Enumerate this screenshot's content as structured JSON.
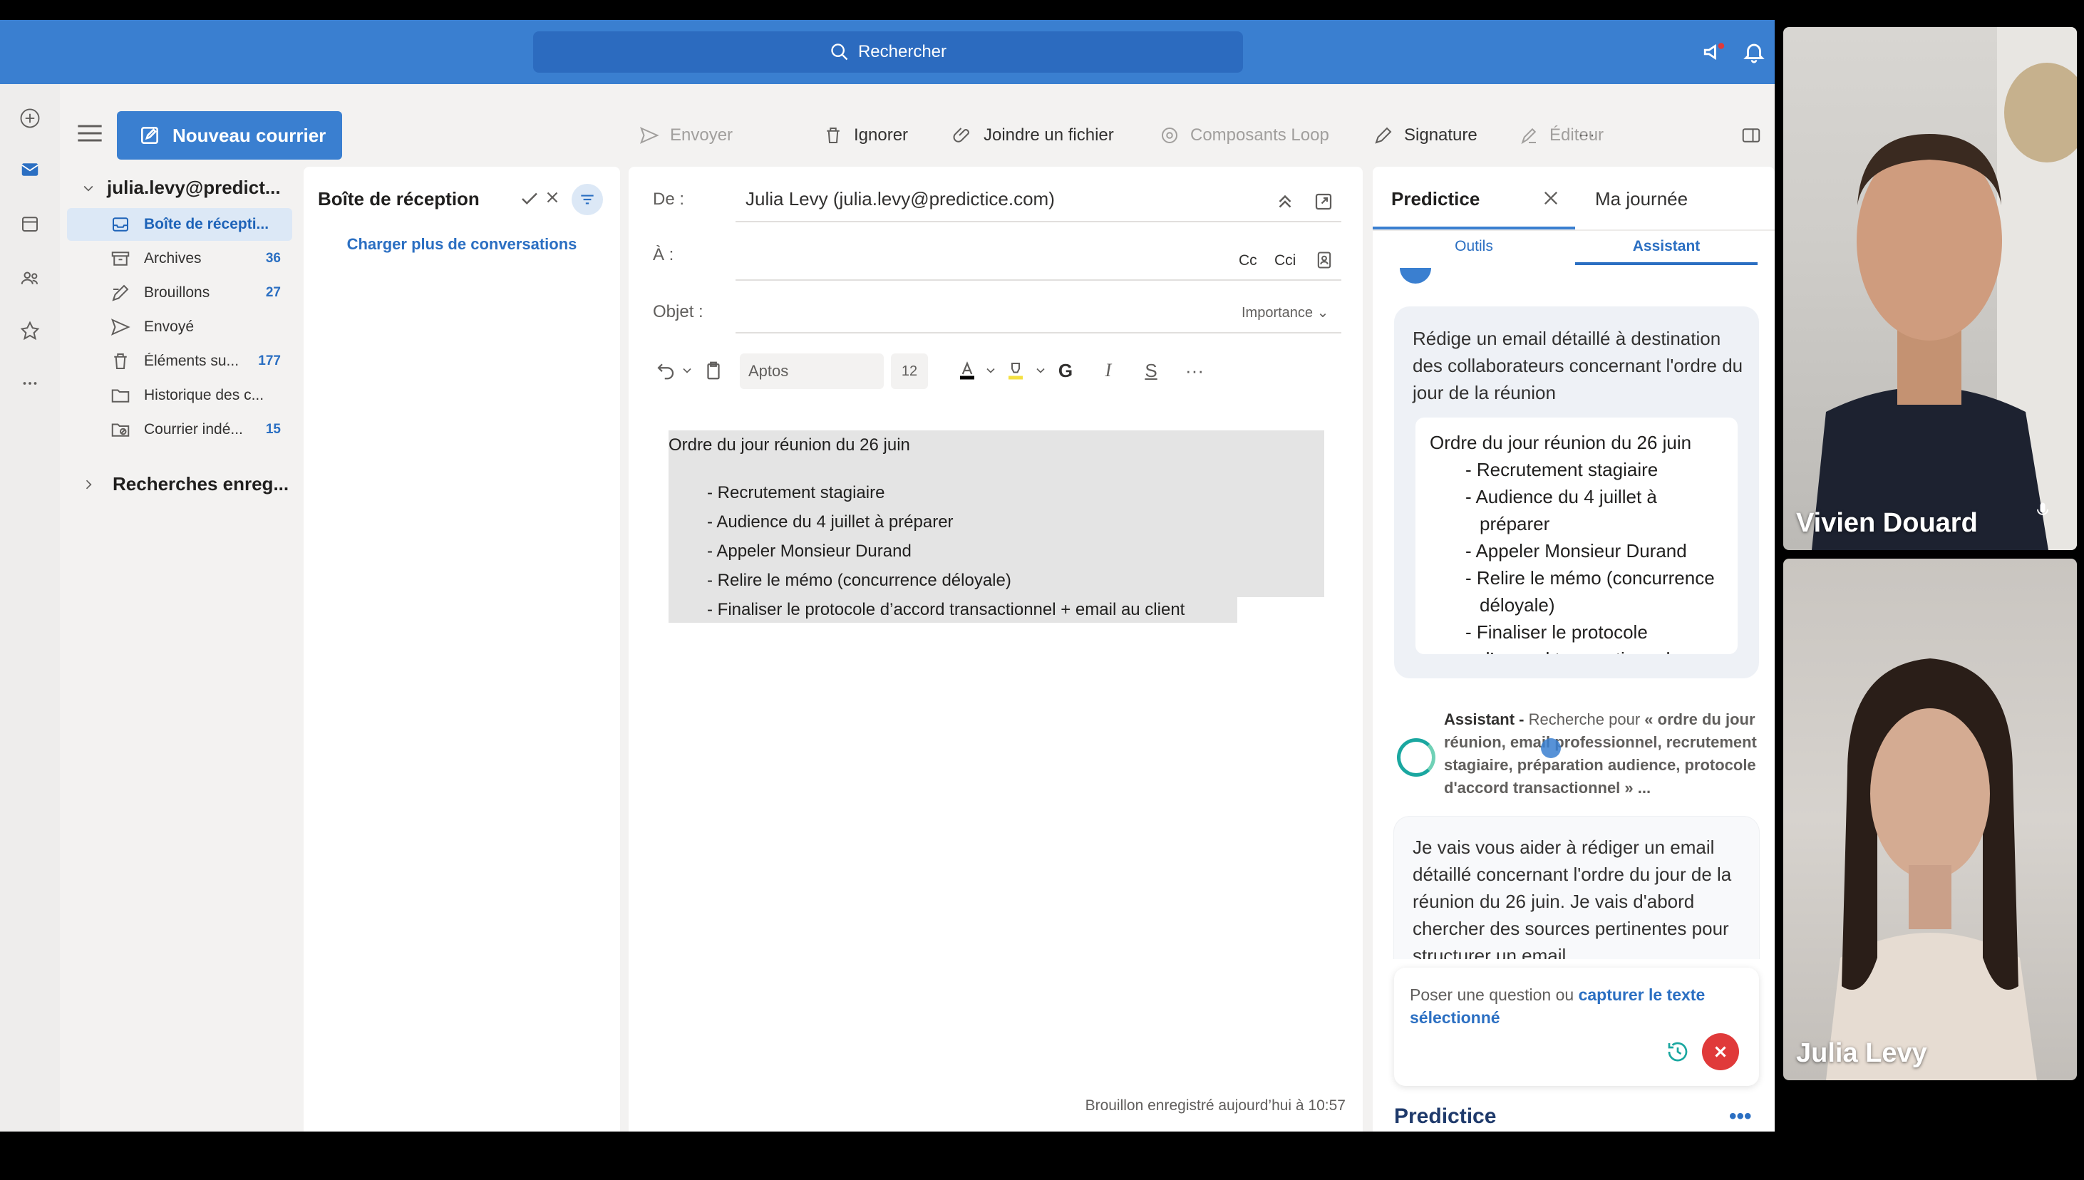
{
  "search": {
    "placeholder": "Rechercher"
  },
  "toolbar": {
    "new_mail": "Nouveau courrier",
    "send": "Envoyer",
    "discard": "Ignorer",
    "attach": "Joindre un fichier",
    "loop": "Composants Loop",
    "signature": "Signature",
    "editor": "Éditeur",
    "more": "···"
  },
  "folders": {
    "account": "julia.levy@predict...",
    "items": [
      {
        "name": "Boîte de récepti...",
        "count": "",
        "icon": "inbox-icon",
        "active": true
      },
      {
        "name": "Archives",
        "count": "36",
        "icon": "archive-icon"
      },
      {
        "name": "Brouillons",
        "count": "27",
        "icon": "draft-icon"
      },
      {
        "name": "Envoyé",
        "count": "",
        "icon": "send-icon"
      },
      {
        "name": "Éléments su...",
        "count": "177",
        "icon": "trash-icon"
      },
      {
        "name": "Historique des c...",
        "count": "",
        "icon": "folder-icon"
      },
      {
        "name": "Courrier indé...",
        "count": "15",
        "icon": "junk-icon"
      }
    ],
    "saved_searches": "Recherches enreg..."
  },
  "message_list": {
    "title": "Boîte de réception",
    "load_more": "Charger plus de conversations"
  },
  "compose": {
    "from_label": "De :",
    "from_value": "Julia Levy (julia.levy@predictice.com)",
    "to_label": "À :",
    "cc": "Cc",
    "cci": "Cci",
    "subject_label": "Objet :",
    "importance": "Importance",
    "font": "Aptos",
    "size": "12",
    "bold": "G",
    "body_title": "Ordre du jour réunion du 26 juin",
    "body_items": [
      "- Recrutement stagiaire",
      "- Audience du 4 juillet à préparer",
      "- Appeler Monsieur Durand",
      "- Relire le mémo (concurrence déloyale)",
      "- Finaliser le protocole d’accord transactionnel + email au client"
    ],
    "draft_saved": "Brouillon enregistré aujourd’hui à 10:57"
  },
  "panel": {
    "tab_active": "Predictice",
    "tab_other": "Ma journée",
    "sub_tools": "Outils",
    "sub_assistant": "Assistant",
    "user_prompt": "Rédige un email détaillé à destination des collaborateurs concernant l'ordre du jour de la réunion",
    "agenda_title": "Ordre du jour réunion du 26 juin",
    "agenda_items": [
      "- Recrutement stagiaire",
      "- Audience du 4 juillet à préparer",
      "- Appeler Monsieur Durand",
      "- Relire le mémo (concurrence déloyale)",
      "- Finaliser le protocole d’accord transactionnel +"
    ],
    "assistant_name": "Assistant -",
    "assistant_search": "Recherche pour",
    "assistant_query": "« ordre du jour réunion, email professionnel, recrutement stagiaire, préparation audience, protocole d'accord transactionnel » ...",
    "reply": "Je vais vous aider à rédiger un email détaillé concernant l'ordre du jour de la réunion du 26 juin. Je vais d'abord chercher des sources pertinentes pour structurer un email",
    "input_placeholder": "Poser une question ou",
    "input_link": "capturer le texte sélectionné",
    "footer_title": "Predictice",
    "footer_more": "•••"
  },
  "participants": [
    {
      "name": "Vivien Douard"
    },
    {
      "name": "Julia Levy"
    }
  ],
  "colors": {
    "brand_blue": "#3a7fd0",
    "link_blue": "#2b6fc2",
    "teal": "#1aa7a0",
    "stop_red": "#e03a3a"
  }
}
